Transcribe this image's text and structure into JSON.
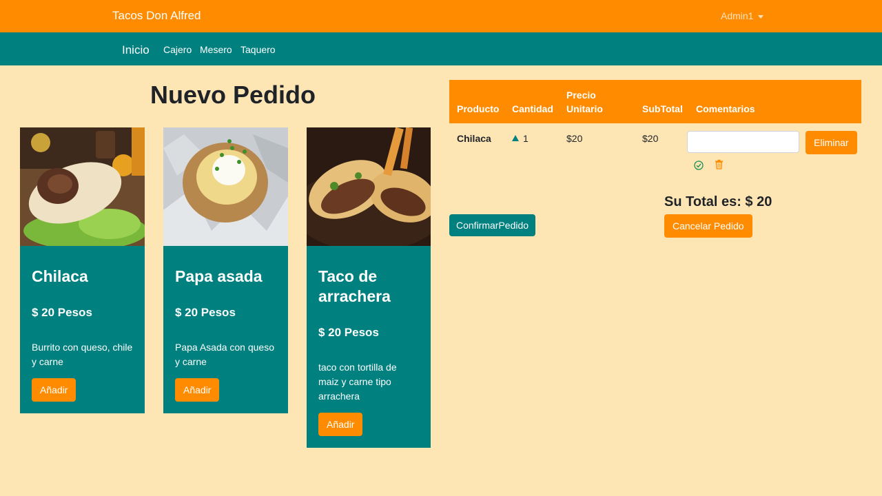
{
  "header": {
    "brand": "Tacos Don Alfred",
    "user": "Admin1"
  },
  "nav": {
    "home": "Inicio",
    "links": [
      "Cajero",
      "Mesero",
      "Taquero"
    ]
  },
  "page": {
    "title": "Nuevo Pedido"
  },
  "products": [
    {
      "name": "Chilaca",
      "price": "$ 20 Pesos",
      "description": "Burrito con queso, chile y carne",
      "button": "Añadir",
      "image": "burrito-photo"
    },
    {
      "name": "Papa asada",
      "price": "$ 20 Pesos",
      "description": "Papa Asada con queso y carne",
      "button": "Añadir",
      "image": "baked-potato-photo"
    },
    {
      "name": "Taco de arrachera",
      "price": "$ 20 Pesos",
      "description": "taco con tortilla de maiz y carne tipo arrachera",
      "button": "Añadir",
      "image": "tacos-photo"
    }
  ],
  "order": {
    "columns": [
      "Producto",
      "Cantidad",
      "Precio Unitario",
      "SubTotal",
      "Comentarios"
    ],
    "rows": [
      {
        "product": "Chilaca",
        "quantity": "1",
        "unit_price": "$20",
        "subtotal": "$20",
        "comment": "",
        "delete_label": "Eliminar"
      }
    ],
    "total_label": "Su Total es: $ 20",
    "confirm_label": "ConfirmarPedido",
    "cancel_label": "Cancelar Pedido"
  },
  "icons": {
    "quantity_up": "triangle-up-icon",
    "confirm": "check-circle-icon",
    "delete": "trash-icon",
    "user_menu": "caret-down-icon"
  },
  "colors": {
    "orange": "#ff8c00",
    "teal": "#00807f",
    "background": "#fde5b4"
  }
}
